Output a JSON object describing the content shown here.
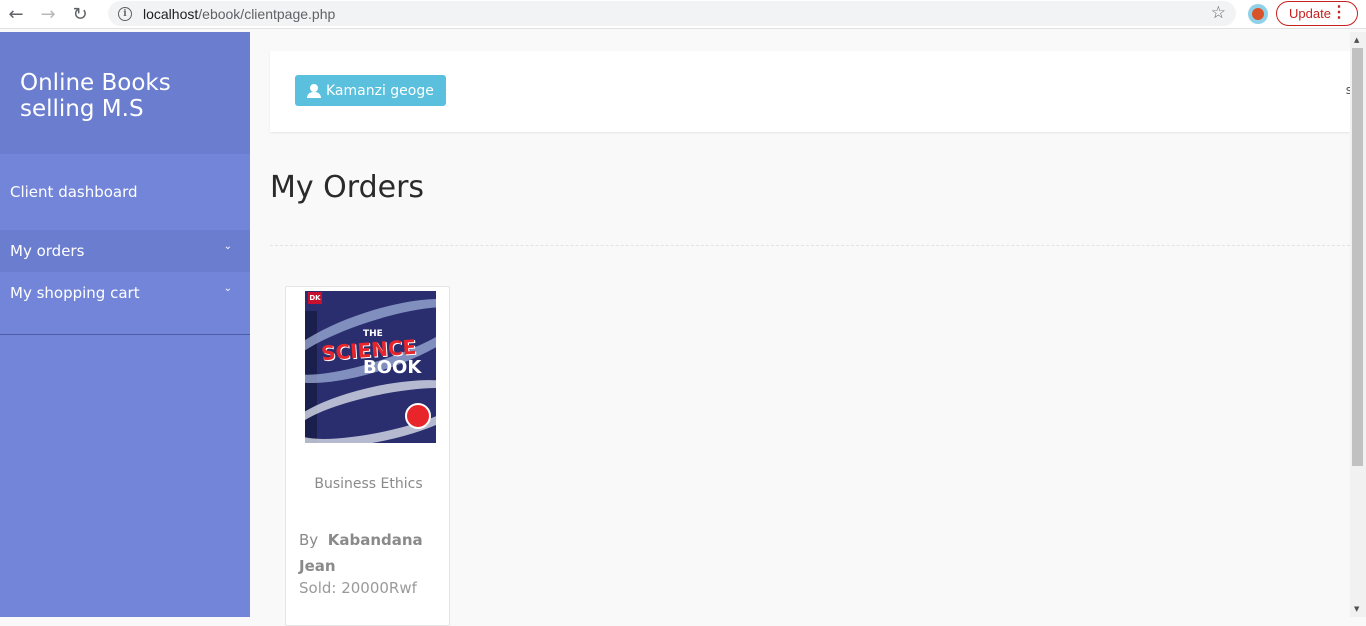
{
  "browser": {
    "url_host": "localhost",
    "url_path": "/ebook/clientpage.php",
    "update_label": "Update",
    "back_icon": "←",
    "forward_icon": "→",
    "reload_icon": "↻",
    "info_icon": "i",
    "star_icon": "☆",
    "menu_icon": "⋮"
  },
  "sidebar": {
    "brand": "Online Books selling M.S",
    "dashboard_label": "Client dashboard",
    "items": [
      {
        "label": "My orders",
        "chevron": "⌄"
      },
      {
        "label": "My shopping cart",
        "chevron": "⌄"
      }
    ]
  },
  "topbar": {
    "user_button": "Kamanzi geoge",
    "cut_text": "s"
  },
  "main": {
    "title": "My Orders",
    "orders": [
      {
        "title": "Business Ethics",
        "by_label": "By",
        "author": "Kabandana Jean",
        "price": "Sold: 20000Rwf",
        "cover": {
          "dk": "DK",
          "the": "THE",
          "science": "SCIENCE",
          "book": "BOOK"
        }
      }
    ]
  },
  "colors": {
    "sidebar": "#7285d8",
    "brand_bg": "#6a7dcf",
    "user_button": "#5bc0de",
    "update": "#c5221f"
  }
}
